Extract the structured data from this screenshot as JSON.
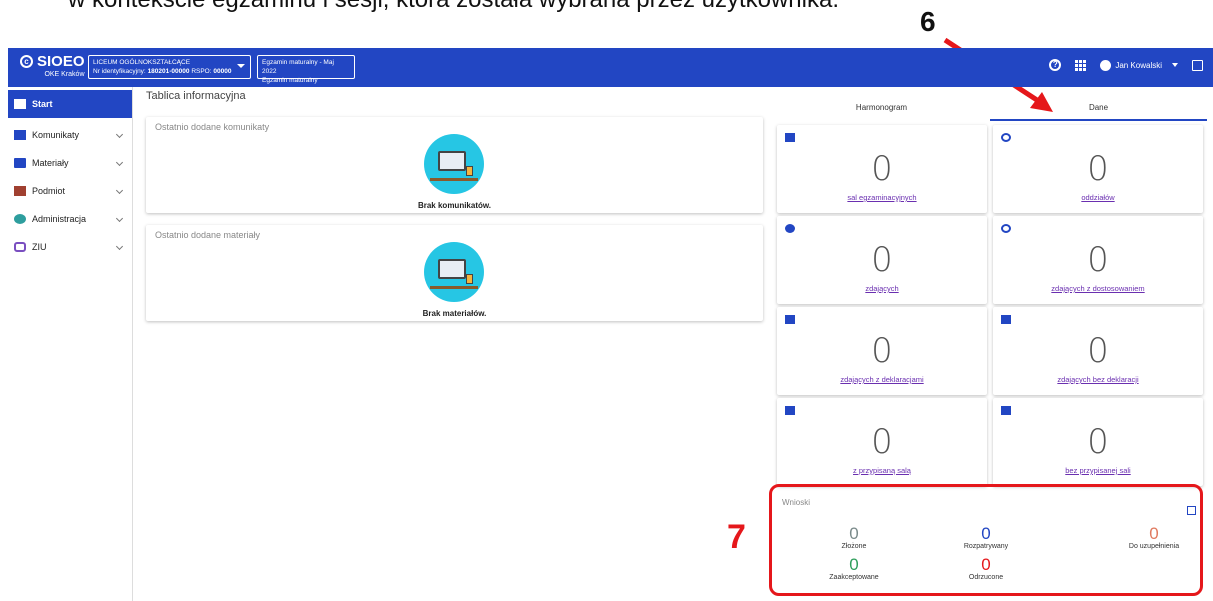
{
  "caption": "w kontekście egzaminu i sesji, która została wybrana przez użytkownika.",
  "annotations": {
    "n6": "6",
    "n7": "7",
    "accent": "#e5171b"
  },
  "topbar": {
    "logo": "SIOEO",
    "logo_sub": "OKE Kraków",
    "school_name": "LICEUM OGÓLNOKSZTAŁCĄCE",
    "school_id_prefix": "Nr identyfikacyjny:",
    "school_id": "180201-00000",
    "rspo_prefix": "RSPO:",
    "rspo": "00000",
    "exam_line1": "Egzamin maturalny - Maj 2022",
    "exam_line2": "Egzamin maturalny",
    "user": "Jan Kowalski",
    "color": "#2246c3"
  },
  "sidebar": {
    "items": [
      {
        "label": "Start",
        "icon": "dashboard-icon"
      },
      {
        "label": "Komunikaty",
        "icon": "message-icon"
      },
      {
        "label": "Materiały",
        "icon": "folder-icon"
      },
      {
        "label": "Podmiot",
        "icon": "institution-icon"
      },
      {
        "label": "Administracja",
        "icon": "shield-icon"
      },
      {
        "label": "ZIU",
        "icon": "ziu-icon"
      }
    ]
  },
  "main": {
    "title": "Tablica informacyjna",
    "cards": [
      {
        "title": "Ostatnio dodane komunikaty",
        "empty": "Brak komunikatów."
      },
      {
        "title": "Ostatnio dodane materiały",
        "empty": "Brak materiałów."
      }
    ]
  },
  "tabs": [
    "Harmonogram",
    "Dane"
  ],
  "stats": [
    {
      "value": "0",
      "label": "sal egzaminacyjnych",
      "icon": "store-icon"
    },
    {
      "value": "0",
      "label": "oddziałów",
      "icon": "copyright-icon"
    },
    {
      "value": "0",
      "label": "zdających",
      "icon": "person-icon"
    },
    {
      "value": "0",
      "label": "zdających z dostosowaniem",
      "icon": "face-icon"
    },
    {
      "value": "0",
      "label": "zdających z deklaracjami",
      "icon": "library-icon"
    },
    {
      "value": "0",
      "label": "zdających bez deklaracji",
      "icon": "library-icon"
    },
    {
      "value": "0",
      "label": "z przypisaną salą",
      "icon": "store-icon"
    },
    {
      "value": "0",
      "label": "bez przypisanej sali",
      "icon": "store-icon"
    }
  ],
  "wnioski": {
    "title": "Wnioski",
    "items": [
      {
        "value": "0",
        "label": "Złożone",
        "color": "#7a8a8a"
      },
      {
        "value": "0",
        "label": "Rozpatrywany",
        "color": "#2246c3"
      },
      {
        "value": "0",
        "label": "Do uzupełnienia",
        "color": "#e07a5f"
      },
      {
        "value": "0",
        "label": "Zaakceptowane",
        "color": "#2e9e5b"
      },
      {
        "value": "0",
        "label": "Odrzucone",
        "color": "#e5171b"
      }
    ]
  }
}
